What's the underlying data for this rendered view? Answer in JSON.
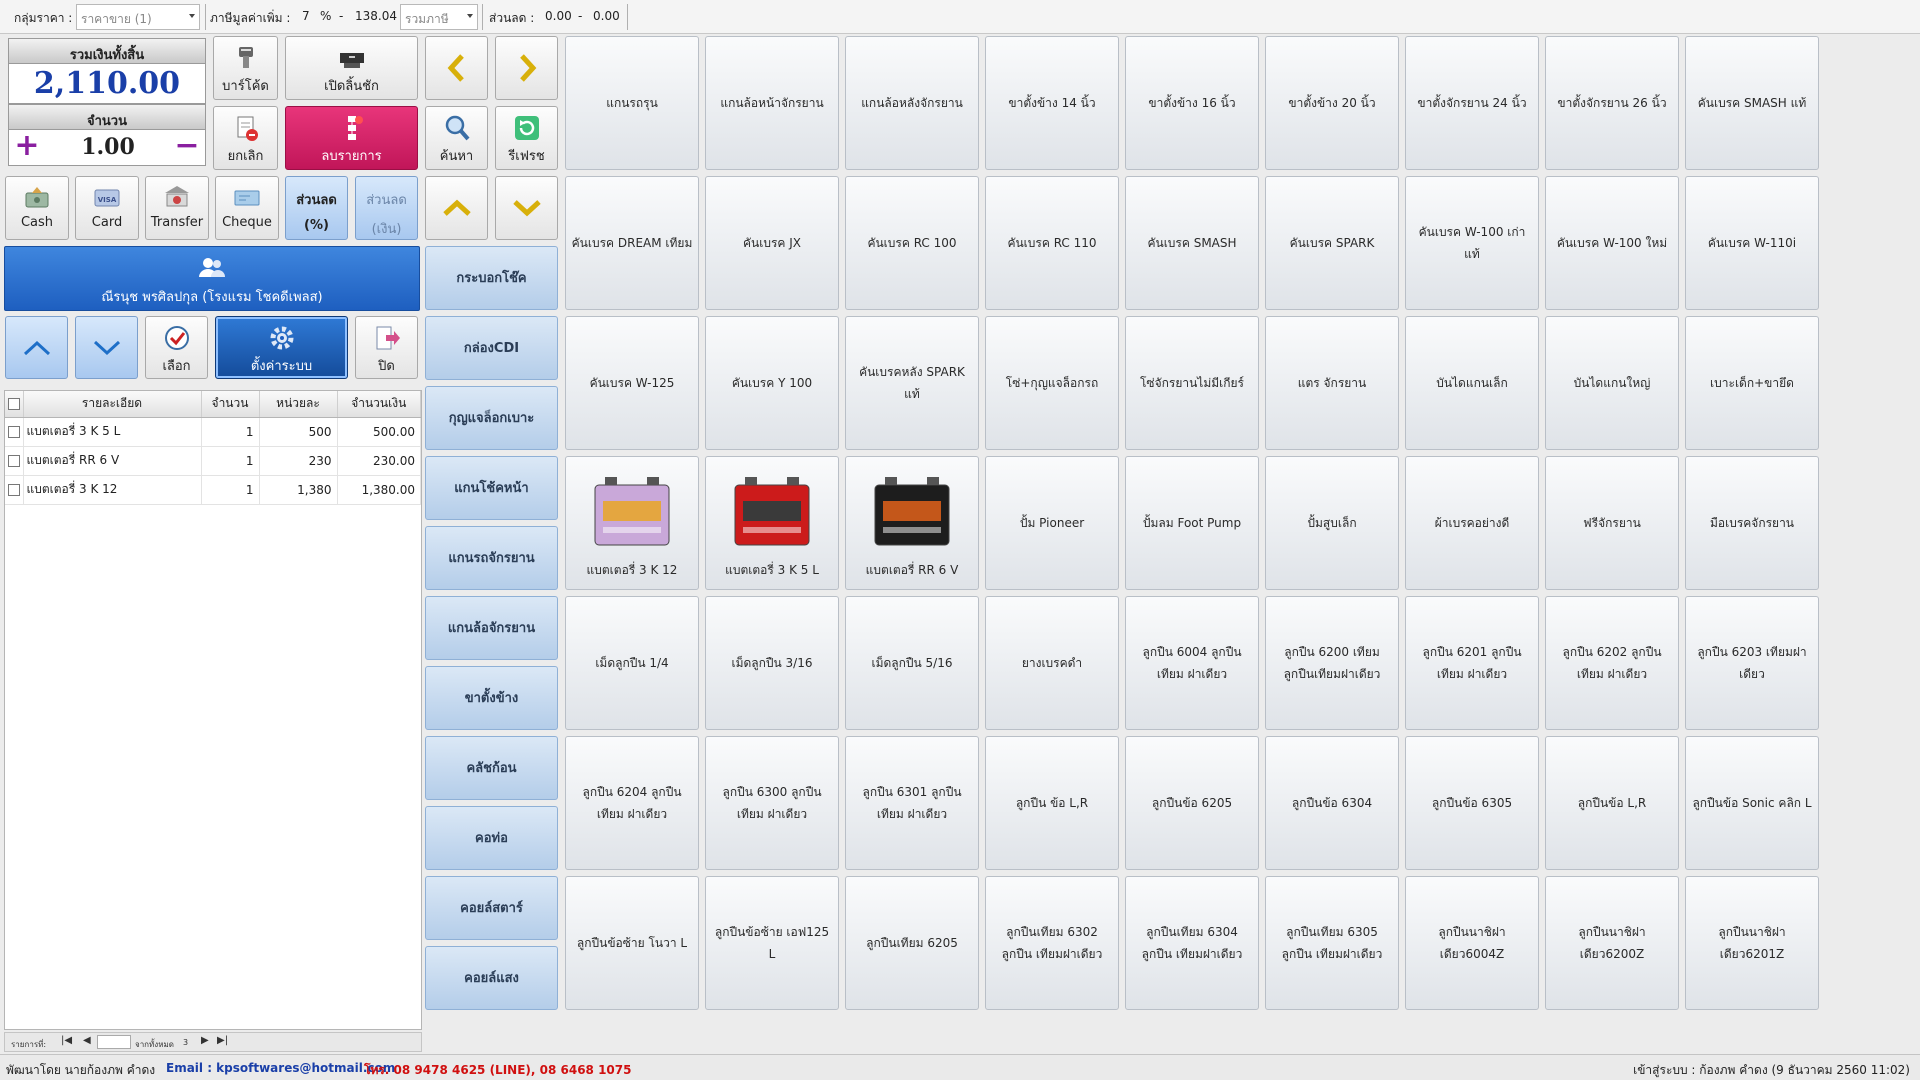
{
  "topbar": {
    "price_group_label": "กลุ่มราคา :",
    "price_group_value": "ราคาขาย (1)",
    "vat_label": "ภาษีมูลค่าเพิ่ม :",
    "vat_rate": "7",
    "vat_unit": "%",
    "vat_dash": "-",
    "vat_amount": "138.04",
    "vat_mode": "รวมภาษี",
    "discount_label": "ส่วนลด :",
    "discount_a": "0.00",
    "discount_dash": "-",
    "discount_b": "0.00"
  },
  "summary": {
    "total_label": "รวมเงินทั้งสิ้น",
    "total_value": "2,110.00",
    "qty_label": "จำนวน",
    "qty_value": "1.00",
    "plus": "+",
    "minus": "−"
  },
  "buttons": {
    "barcode": "บาร์โค้ด",
    "open_drawer": "เปิดลิ้นชัก",
    "cancel": "ยกเลิก",
    "delete_item": "ลบรายการ",
    "search": "ค้นหา",
    "refresh": "รีเฟรช",
    "cash": "Cash",
    "card": "Card",
    "transfer": "Transfer",
    "cheque": "Cheque",
    "discount_pct_1": "ส่วนลด",
    "discount_pct_2": "(%)",
    "discount_amt_1": "ส่วนลด",
    "discount_amt_2": "(เงิน)",
    "select": "เลือก",
    "settings": "ตั้งค่าระบบ",
    "close": "ปิด"
  },
  "customer": {
    "name": "ณีรนุช พรศิลปกุล (โรงแรม โชคดีเพลส)"
  },
  "table": {
    "headers": [
      "รายละเอียด",
      "จำนวน",
      "หน่วยละ",
      "จำนวนเงิน"
    ],
    "rows": [
      {
        "name": "แบตเตอรี่ 3 K 5 L",
        "qty": "1",
        "unit": "500",
        "amount": "500.00"
      },
      {
        "name": "แบตเตอรี่ RR 6 V",
        "qty": "1",
        "unit": "230",
        "amount": "230.00"
      },
      {
        "name": "แบตเตอรี่ 3 K 12",
        "qty": "1",
        "unit": "1,380",
        "amount": "1,380.00"
      }
    ]
  },
  "pager": {
    "records_label": "รายการที่:",
    "total_label": "จากทั้งหมด",
    "total": "3"
  },
  "categories": [
    "กระบอกโช๊ค",
    "กล่องCDI",
    "กุญแจล็อกเบาะ",
    "แกนโช้คหน้า",
    "แกนรถจักรยาน",
    "แกนล้อจักรยาน",
    "ขาตั้งข้าง",
    "คลัชก้อน",
    "คอท่อ",
    "คอยล์สตาร์",
    "คอยล์แสง"
  ],
  "products": [
    [
      "แกนรถรุน",
      "แกนล้อหน้าจักรยาน",
      "แกนล้อหลังจักรยาน",
      "ขาตั้งข้าง 14 นิ้ว",
      "ขาตั้งข้าง 16 นิ้ว",
      "ขาตั้งข้าง 20 นิ้ว",
      "ขาตั้งจักรยาน 24 นิ้ว",
      "ขาตั้งจักรยาน 26 นิ้ว",
      "คันเบรค SMASH แท้"
    ],
    [
      "คันเบรค DREAM เทียม",
      "คันเบรค JX",
      "คันเบรค RC 100",
      "คันเบรค RC 110",
      "คันเบรค SMASH",
      "คันเบรค SPARK",
      "คันเบรค W-100 เก่า แท้",
      "คันเบรค W-100 ใหม่",
      "คันเบรค W-110i"
    ],
    [
      "คันเบรค W-125",
      "คันเบรค Y 100",
      "คันเบรคหลัง SPARK แท้",
      "โซ่+กุญแจล็อกรถ",
      "โซ่จักรยานไม่มีเกียร์",
      "แตร จักรยาน",
      "บันไดแกนเล็ก",
      "บันไดแกนใหญ่",
      "เบาะเด็ก+ขายึด"
    ],
    [
      "แบตเตอรี่ 3 K 12",
      "แบตเตอรี่ 3 K 5 L",
      "แบตเตอรี่ RR 6 V",
      "ปั้ม Pioneer",
      "ปั้มลม Foot Pump",
      "ปั้มสูบเล็ก",
      "ผ้าเบรคอย่างดี",
      "ฟรีจักรยาน",
      "มือเบรคจักรยาน"
    ],
    [
      "เม็ดลูกปืน 1/4",
      "เม็ดลูกปืน 3/16",
      "เม็ดลูกปืน 5/16",
      "ยางเบรคดำ",
      "ลูกปืน 6004 ลูกปืนเทียม ฝาเดียว",
      "ลูกปืน 6200 เทียม ลูกปืนเทียมฝาเดียว",
      "ลูกปืน 6201 ลูกปืนเทียม ฝาเดียว",
      "ลูกปืน 6202 ลูกปืนเทียม ฝาเดียว",
      "ลูกปืน 6203 เทียมฝา เดียว"
    ],
    [
      "ลูกปืน 6204 ลูกปืนเทียม ฝาเดียว",
      "ลูกปืน 6300 ลูกปืนเทียม ฝาเดียว",
      "ลูกปืน 6301 ลูกปืนเทียม ฝาเดียว",
      "ลูกปืน ข้อ L,R",
      "ลูกปืนข้อ 6205",
      "ลูกปืนข้อ 6304",
      "ลูกปืนข้อ 6305",
      "ลูกปืนข้อ L,R",
      "ลูกปืนข้อ Sonic คลิก L"
    ],
    [
      "ลูกปืนข้อซ้าย โนวา L",
      "ลูกปืนข้อซ้าย เอฟ125 L",
      "ลูกปืนเทียม 6205",
      "ลูกปืนเทียม 6302 ลูกปืน เทียมฝาเดียว",
      "ลูกปืนเทียม 6304 ลูกปืน เทียมฝาเดียว",
      "ลูกปืนเทียม 6305 ลูกปืน เทียมฝาเดียว",
      "ลูกปืนนาชิฝาเดียว6004Z",
      "ลูกปืนนาชิฝาเดียว6200Z",
      "ลูกปืนนาชิฝาเดียว6201Z"
    ]
  ],
  "status": {
    "dev": "พัฒนาโดย นายก้องภพ คำดง",
    "email": "Email : kpsoftwares@hotmail.com",
    "phone": "โทร. 08 9478 4625 (LINE), 08 6468 1075",
    "login": "เข้าสู่ระบบ : ก้องภพ คำดง (9 ธันวาคม 2560 11:02)"
  },
  "colors": {
    "accent_blue": "#1e5fc0",
    "pink": "#c11659",
    "total_blue": "#1a3fa8",
    "email_blue": "#1a3fa8",
    "phone_red": "#d01010"
  }
}
